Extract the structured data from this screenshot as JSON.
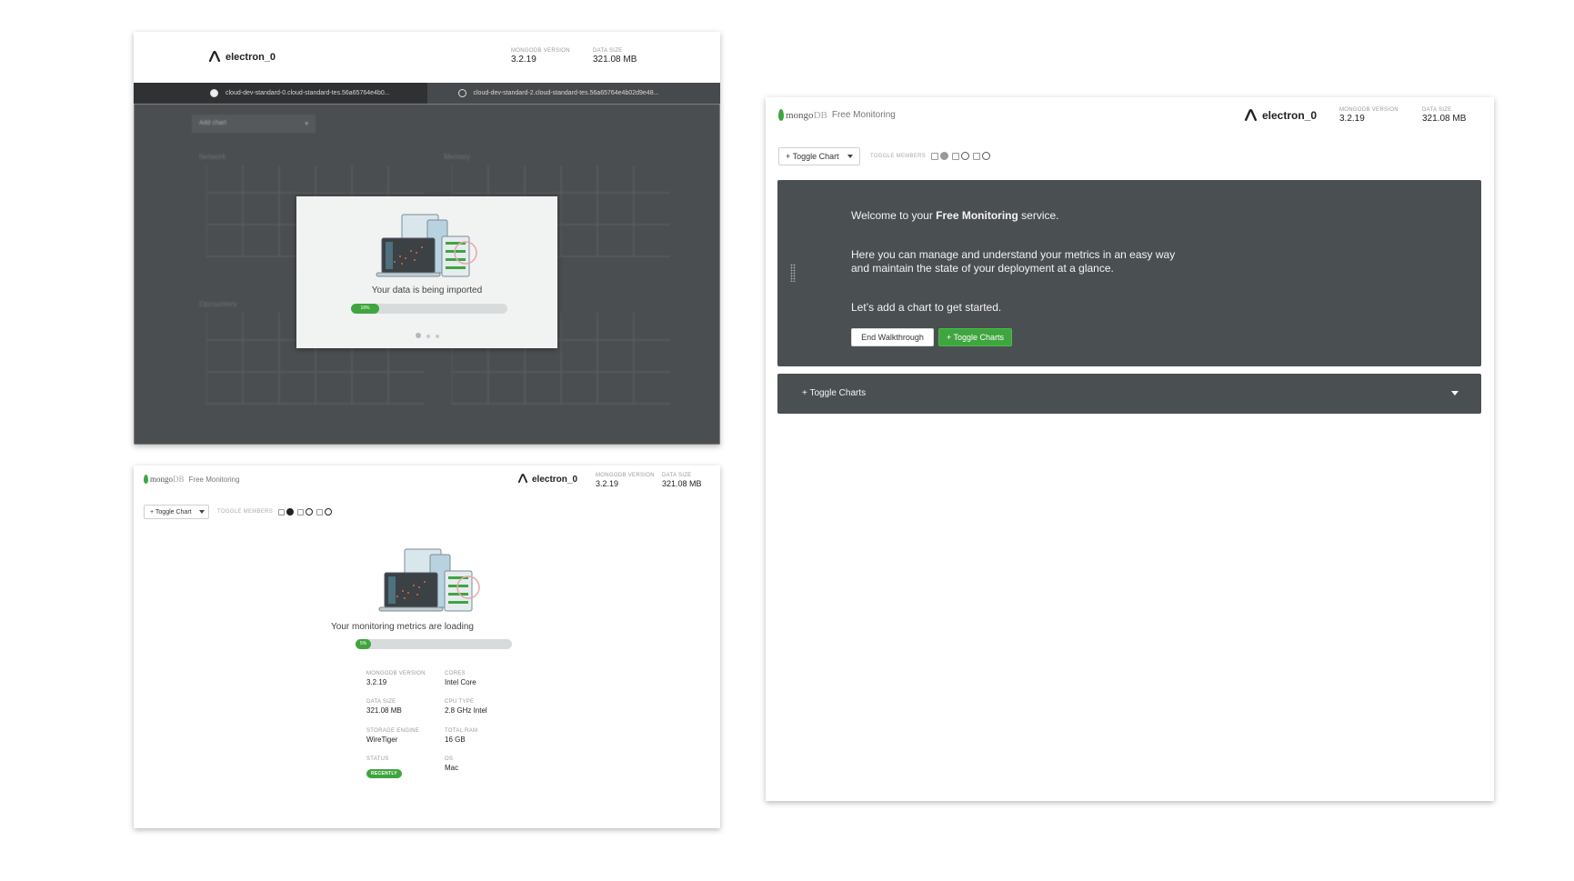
{
  "server": {
    "name": "electron_0",
    "mongodb_version_label": "MONGODB VERSION",
    "mongodb_version": "3.2.19",
    "data_size_label": "DATA SIZE",
    "data_size": "321.08 MB"
  },
  "brand": {
    "logo_word": "mongo",
    "logo_word_suffix": "DB",
    "product": "Free Monitoring",
    "accent": "#3fa53f",
    "dark_panel": "#4a4f51"
  },
  "import_panel": {
    "tabs": [
      {
        "label": "cloud-dev-standard-0.cloud-standard-tes.56a65764e4b0...",
        "active": true
      },
      {
        "label": "cloud-dev-standard-2.cloud-standard-tes.56a65764e4b02d9e48...",
        "active": false
      }
    ],
    "add_chart_label": "Add chart",
    "chart_titles": [
      "Network",
      "Memory",
      "Opcounters",
      ""
    ],
    "modal": {
      "message": "Your data is being imported",
      "progress_label": "18%",
      "progress": 0.18,
      "pager_count": 3,
      "pager_active": 0
    }
  },
  "loading_panel": {
    "toggle_chart_label": "+ Toggle Chart",
    "members_label": "TOGGLE MEMBERS",
    "message": "Your monitoring metrics are loading",
    "progress_label": "5%",
    "progress": 0.05,
    "info": [
      {
        "label": "MONGODB VERSION",
        "value": "3.2.19"
      },
      {
        "label": "CORES",
        "value": "Intel Core"
      },
      {
        "label": "DATA SIZE",
        "value": "321.08 MB"
      },
      {
        "label": "CPU TYPE",
        "value": "2.8 GHz Intel"
      },
      {
        "label": "STORAGE ENGINE",
        "value": "WireTiger"
      },
      {
        "label": "TOTAL RAM",
        "value": "16 GB"
      },
      {
        "label": "STATUS",
        "value": "RECENTLY"
      },
      {
        "label": "OS",
        "value": "Mac"
      }
    ]
  },
  "walkthrough_panel": {
    "toggle_chart_label": "+ Toggle Chart",
    "members_label": "TOGGLE MEMBERS",
    "welcome_prefix": "Welcome to your ",
    "welcome_bold": "Free Monitoring",
    "welcome_suffix": " service.",
    "line2": "Here you can manage and understand your metrics in an easy way",
    "line3": "and maintain the state of your deployment at a glance.",
    "line4": "Let’s add a chart to get started.",
    "end_walkthrough_label": "End Walkthrough",
    "toggle_charts_button_label": "+ Toggle Charts",
    "toggle_charts_bar_label": "+ Toggle Charts"
  }
}
